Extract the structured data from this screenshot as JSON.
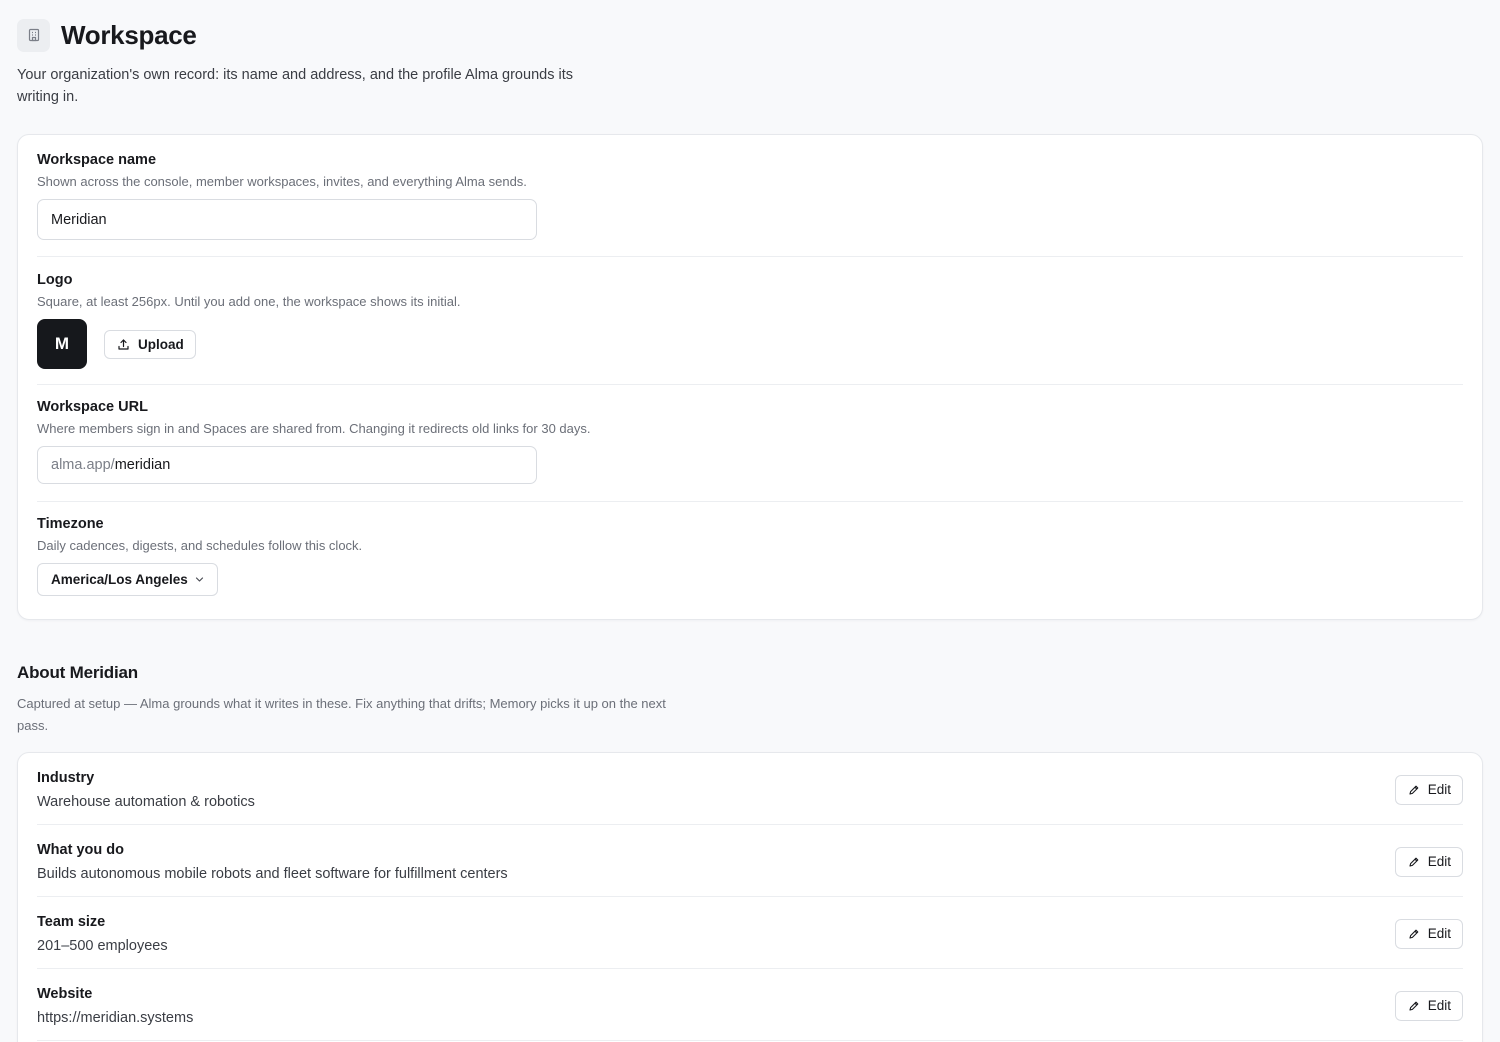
{
  "header": {
    "title": "Workspace",
    "subtitle": "Your organization's own record: its name and address, and the profile Alma grounds its writing in.",
    "icon": "building-icon"
  },
  "general": {
    "name": {
      "label": "Workspace name",
      "help": "Shown across the console, member workspaces, invites, and everything Alma sends.",
      "value": "Meridian"
    },
    "logo": {
      "label": "Logo",
      "help": "Square, at least 256px. Until you add one, the workspace shows its initial.",
      "initial": "M",
      "upload_label": "Upload",
      "upload_icon": "upload-icon"
    },
    "url": {
      "label": "Workspace URL",
      "help": "Where members sign in and Spaces are shared from. Changing it redirects old links for 30 days.",
      "prefix": "alma.app/",
      "slug": "meridian"
    },
    "timezone": {
      "label": "Timezone",
      "help": "Daily cadences, digests, and schedules follow this clock.",
      "value": "America/Los Angeles",
      "icon": "chevron-down-icon"
    }
  },
  "about": {
    "title": "About Meridian",
    "subtitle": "Captured at setup — Alma grounds what it writes in these. Fix anything that drifts; Memory picks it up on the next pass.",
    "edit_label": "Edit",
    "edit_icon": "pencil-icon",
    "rows": [
      {
        "label": "Industry",
        "value": "Warehouse automation & robotics"
      },
      {
        "label": "What you do",
        "value": "Builds autonomous mobile robots and fleet software for fulfillment centers"
      },
      {
        "label": "Team size",
        "value": "201–500 employees"
      },
      {
        "label": "Website",
        "value": "https://meridian.systems"
      }
    ]
  },
  "colors": {
    "background": "#f8f9fb",
    "card": "#ffffff",
    "text": "#18191d",
    "muted": "#6b6f78",
    "border": "#d9dce1",
    "logo_tile": "#16181c"
  }
}
